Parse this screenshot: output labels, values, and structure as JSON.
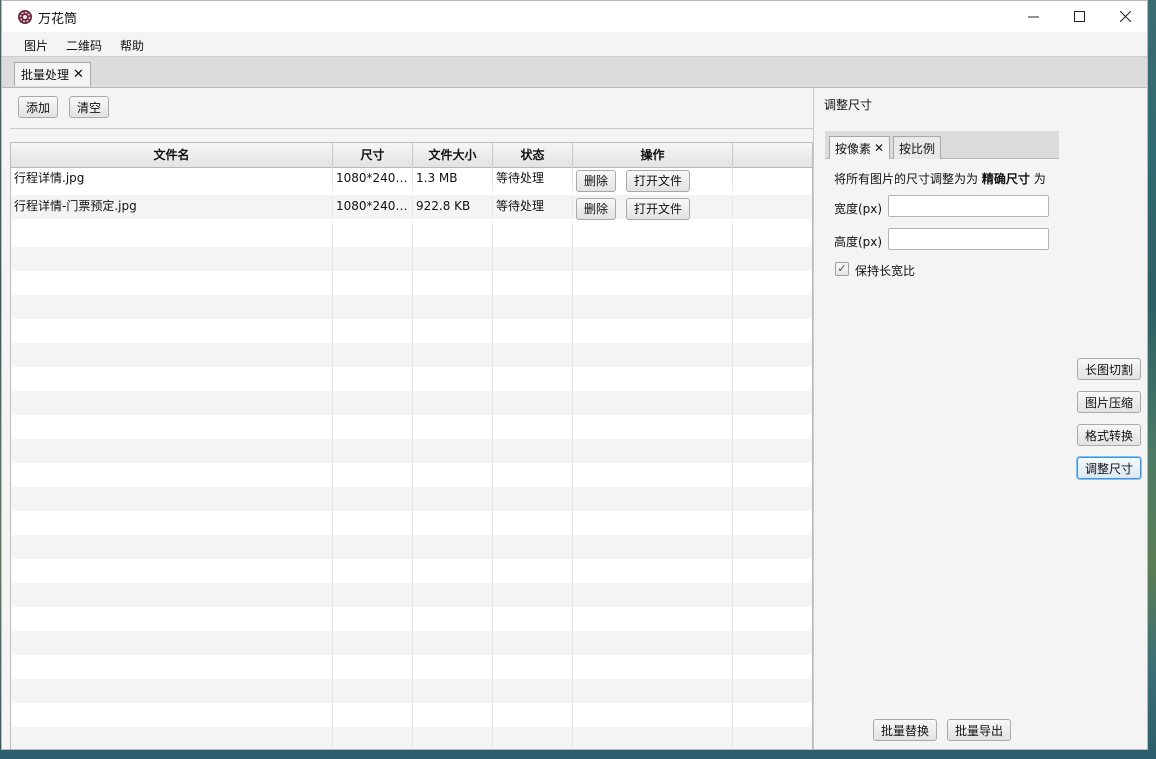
{
  "window": {
    "title": "万花筒"
  },
  "menu": [
    "图片",
    "二维码",
    "帮助"
  ],
  "main_tab": {
    "label": "批量处理",
    "close": "✕"
  },
  "toolbar": {
    "add": "添加",
    "clear": "清空"
  },
  "table": {
    "headers": [
      "文件名",
      "尺寸",
      "文件大小",
      "状态",
      "操作"
    ],
    "rows": [
      {
        "name": "行程详情.jpg",
        "size": "1080*2400...",
        "filesize": "1.3 MB",
        "status": "等待处理",
        "delete": "删除",
        "open": "打开文件"
      },
      {
        "name": "行程详情-门票预定.jpg",
        "size": "1080*2400...",
        "filesize": "922.8 KB",
        "status": "等待处理",
        "delete": "删除",
        "open": "打开文件"
      }
    ]
  },
  "panel": {
    "title": "调整尺寸",
    "tabs": {
      "pixel": "按像素",
      "close": "✕",
      "ratio": "按比例"
    },
    "desc_prefix": "将所有图片的尺寸调整为为",
    "desc_bold": "精确尺寸",
    "desc_suffix": "为",
    "width_label": "宽度(px)",
    "height_label": "高度(px)",
    "width_value": "",
    "height_value": "",
    "keep_ratio_label": "保持长宽比",
    "keep_ratio_checked": true
  },
  "side_buttons": {
    "split": "长图切割",
    "compress": "图片压缩",
    "convert": "格式转换",
    "resize": "调整尺寸"
  },
  "bottom_buttons": {
    "replace": "批量替换",
    "export": "批量导出"
  },
  "icons": {
    "app": "kaleidoscope-icon"
  },
  "colors": {
    "selected_border": "#3f94d9",
    "window_bg": "#f4f4f4"
  }
}
